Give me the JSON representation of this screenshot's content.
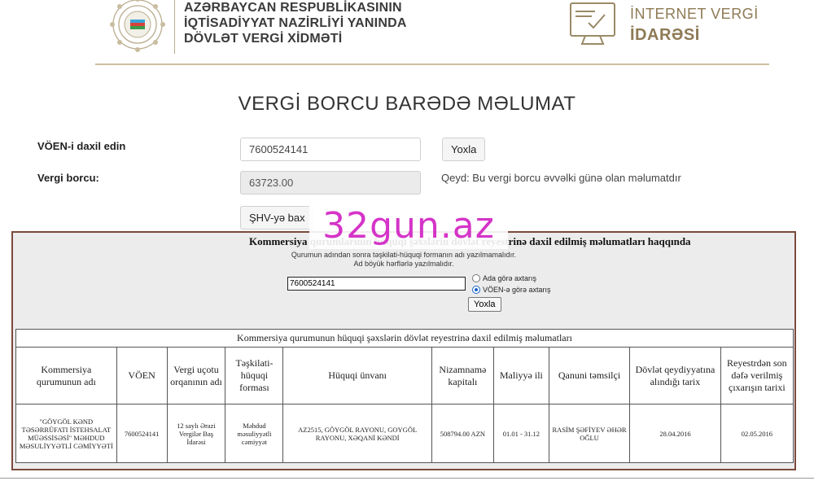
{
  "header": {
    "org_line1": "AZƏRBAYCAN RESPUBLİKASININ",
    "org_line2": "İQTİSADİYYAT NAZİRLİYİ YANINDA",
    "org_line3": "DÖVLƏT VERGİ XİDMƏTİ",
    "portal_line1": "İNTERNET VERGİ",
    "portal_line2": "İDARƏSİ"
  },
  "page_title": "VERGİ BORCU BARƏDƏ MƏLUMAT",
  "form": {
    "voen_label": "VÖEN-i daxil edin",
    "voen_value": "7600524141",
    "check_button": "Yoxla",
    "debt_label": "Vergi borcu:",
    "debt_value": "63723.00",
    "note": "Qeyd: Bu vergi borcu əvvəlki günə olan məlumatdır",
    "shv_button": "ŞHV-yə bax"
  },
  "watermark": "32gun.az",
  "panel": {
    "title": "Kommersiya qurumlarının hüquqi şəxslərin dövlət reyestrinə daxil edilmiş məlumatları haqqında",
    "hint1": "Qurumun adından sonra təşkilati-hüquqi formanın adı yazılmamalıdır.",
    "hint2": "Ad böyük hərflərlə yazılmalıdır.",
    "search_value": "7600524141",
    "radio_name": "Ada görə axtarış",
    "radio_voen": "VÖEN-ə görə axtarış",
    "check_button": "Yoxla",
    "table": {
      "caption": "Kommersiya qurumunun hüquqi şəxslərin dövlət reyestrinə daxil edilmiş məlumatları",
      "headers": [
        "Kommersiya qurumunun adı",
        "VÖEN",
        "Vergi uçotu orqanının adı",
        "Təşkilati-hüquqi forması",
        "Hüquqi ünvanı",
        "Nizamnamə kapitalı",
        "Maliyyə ili",
        "Qanuni təmsilçi",
        "Dövlət qeydiyyatına alındığı tarix",
        "Reyestrdən son dəfə verilmiş çıxarışın tarixi"
      ],
      "row": [
        "\"GÖYGÖL KƏND TƏSƏRRÜFATI İSTEHSALAT MÜƏSSİSƏSİ\" MƏHDUD MƏSULİYYƏTLİ CƏMİYYƏTİ",
        "7600524141",
        "12 saylı Ərazi Vergilər Baş İdarəsi",
        "Məhdud məsuliyyətli cəmiyyət",
        "AZ2515, GÖYGÖL RAYONU, GOYGÖL RAYONU, XƏQANİ KƏNDİ",
        "508794.00 AZN",
        "01.01 - 31.12",
        "RASİM ŞƏFİYEV ƏHƏR OĞLU",
        "28.04.2016",
        "02.05.2016"
      ]
    }
  },
  "colors": {
    "brand_gold": "#8e7a55",
    "panel_border": "#7b4a3c",
    "watermark": "#d534c8"
  }
}
